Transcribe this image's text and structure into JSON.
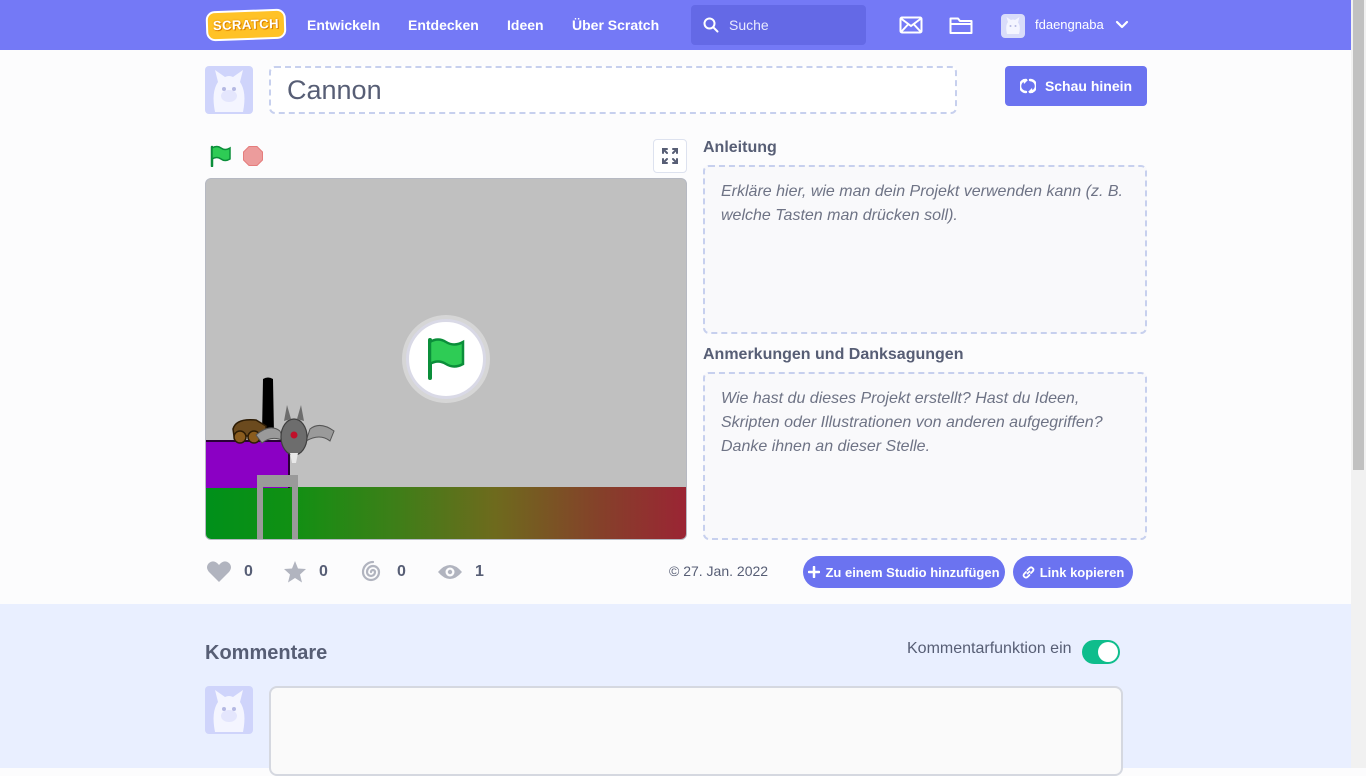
{
  "nav": {
    "logo_text": "SCRATCH",
    "links": [
      "Entwickeln",
      "Entdecken",
      "Ideen",
      "Über Scratch"
    ],
    "search_placeholder": "Suche",
    "username": "fdaengnaba"
  },
  "project": {
    "title": "Cannon",
    "see_inside_label": "Schau hinein"
  },
  "stats": {
    "loves": "0",
    "favorites": "0",
    "remixes": "0",
    "views": "1",
    "date": "© 27. Jan. 2022"
  },
  "actions": {
    "add_to_studio": "Zu einem Studio hinzufügen",
    "copy_link": "Link kopieren"
  },
  "instructions": {
    "label": "Anleitung",
    "placeholder": "Erkläre hier, wie man dein Projekt verwenden kann (z. B. welche Tasten man drücken soll)."
  },
  "notes": {
    "label": "Anmerkungen und Danksagungen",
    "placeholder": "Wie hast du dieses Projekt erstellt? Hast du Ideen, Skripten oder Illustrationen von anderen aufgegriffen? Danke ihnen an dieser Stelle."
  },
  "comments": {
    "title": "Kommentare",
    "toggle_label": "Kommentarfunktion ein",
    "toggle_on": true
  },
  "colors": {
    "nav_bg": "#7479f6",
    "accent": "#6b73f0",
    "green_flag": "#0fbd8c",
    "stop": "#ec9c9c",
    "comments_bg": "#e9efff"
  },
  "icons": [
    "search-icon",
    "messages-icon",
    "my-stuff-folder-icon",
    "chevron-down-icon",
    "see-inside-icon",
    "green-flag-icon",
    "stop-icon",
    "fullscreen-icon",
    "love-icon",
    "favorite-icon",
    "remix-icon",
    "view-icon",
    "plus-icon",
    "link-icon"
  ]
}
